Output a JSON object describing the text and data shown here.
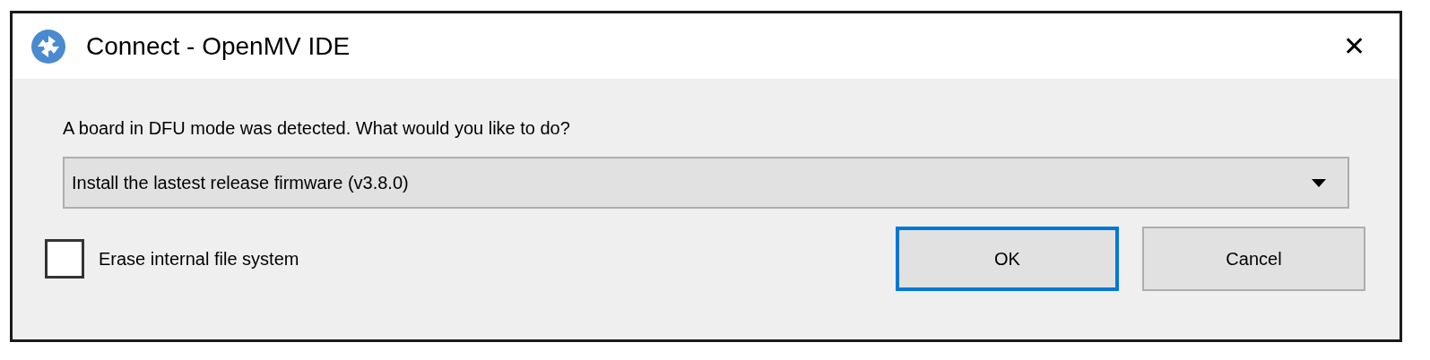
{
  "window": {
    "title": "Connect - OpenMV IDE",
    "close": "✕"
  },
  "prompt": "A board in DFU mode was detected. What would you like to do?",
  "dropdown": {
    "value": "Install the lastest release firmware (v3.8.0)"
  },
  "checkbox": {
    "label": "Erase internal file system",
    "checked": false
  },
  "buttons": [
    {
      "label": "OK",
      "selected": true
    },
    {
      "label": "Cancel",
      "selected": false
    }
  ]
}
